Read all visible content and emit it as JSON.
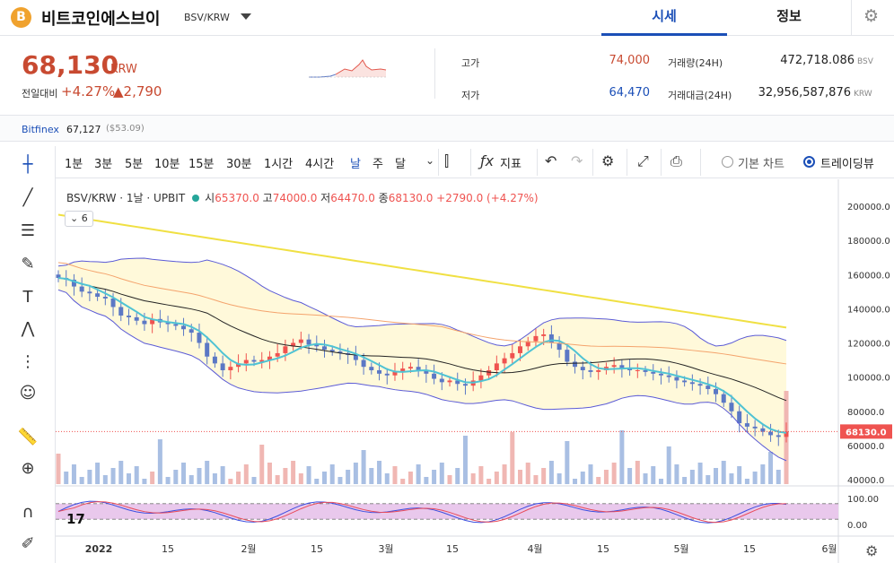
{
  "header": {
    "coin_logo": "B",
    "coin_name": "비트코인에스브이",
    "pair": "BSV/KRW",
    "tabs": [
      "시세",
      "정보"
    ]
  },
  "price": {
    "current": "68,130",
    "unit": "KRW",
    "change_label": "전일대비",
    "change_pct": "+4.27%",
    "change_abs": "▲2,790"
  },
  "stats": {
    "high_label": "고가",
    "high": "74,000",
    "low_label": "저가",
    "low": "64,470",
    "volume_label": "거래량(24H)",
    "volume": "472,718.086",
    "volume_unit": "BSV",
    "value_label": "거래대금(24H)",
    "value": "32,956,587,876",
    "value_unit": "KRW"
  },
  "reference": {
    "exchange": "Bitfinex",
    "price": "67,127",
    "usd": "($53.09)"
  },
  "toolbar": {
    "intervals": [
      "1분",
      "3분",
      "5분",
      "10분",
      "15분",
      "30분",
      "1시간",
      "4시간",
      "날",
      "주",
      "달"
    ],
    "active_interval": "날",
    "indicator_label": "지표",
    "basic_chart": "기본 차트",
    "trading_view": "트레이딩뷰"
  },
  "legend": {
    "symbol": "BSV/KRW · 1날 · UPBIT",
    "o_label": "시",
    "o": "65370.0",
    "h_label": "고",
    "h": "74000.0",
    "l_label": "저",
    "l": "64470.0",
    "c_label": "종",
    "c": "68130.0",
    "change": "+2790.0 (+4.27%)",
    "indicator_count": "6"
  },
  "colors": {
    "up": "#ef5350",
    "down": "#5b78c5",
    "accent": "#1b4fb7",
    "price_red": "#c84a31"
  },
  "chart_data": {
    "type": "candlestick",
    "y_axis_ticks": [
      "200000.0",
      "180000.0",
      "160000.0",
      "140000.0",
      "120000.0",
      "100000.0",
      "80000.0",
      "60000.0",
      "40000.0"
    ],
    "ylim": [
      40000,
      200000
    ],
    "x_axis_ticks": [
      "2022",
      "15",
      "2월",
      "15",
      "3월",
      "15",
      "4월",
      "15",
      "5월",
      "15",
      "6월"
    ],
    "last_price_label": "68130.0",
    "closes": [
      158000,
      157000,
      153000,
      150000,
      149000,
      147000,
      146000,
      141000,
      136000,
      135000,
      133000,
      131000,
      134000,
      132000,
      131000,
      130000,
      128000,
      126000,
      120000,
      112000,
      108000,
      104000,
      106000,
      108000,
      110000,
      109000,
      110000,
      112000,
      114000,
      118000,
      120000,
      122000,
      119000,
      118000,
      116000,
      115000,
      114000,
      113000,
      110000,
      106000,
      104000,
      102000,
      101000,
      103000,
      105000,
      106000,
      104000,
      102000,
      99000,
      97000,
      98000,
      96000,
      95000,
      98000,
      101000,
      104000,
      108000,
      111000,
      114000,
      118000,
      121000,
      124000,
      125000,
      120000,
      116000,
      109000,
      106000,
      104000,
      103000,
      104000,
      106000,
      107000,
      105000,
      104000,
      104000,
      103000,
      102000,
      101000,
      100000,
      98000,
      97000,
      96000,
      95000,
      93000,
      90000,
      85000,
      80000,
      73000,
      71000,
      70000,
      68000,
      66000,
      65000,
      68130
    ],
    "oscillator": {
      "ticks": [
        "100.00",
        "0.00"
      ],
      "ylim": [
        0,
        100
      ],
      "bands": [
        80,
        20
      ]
    }
  }
}
